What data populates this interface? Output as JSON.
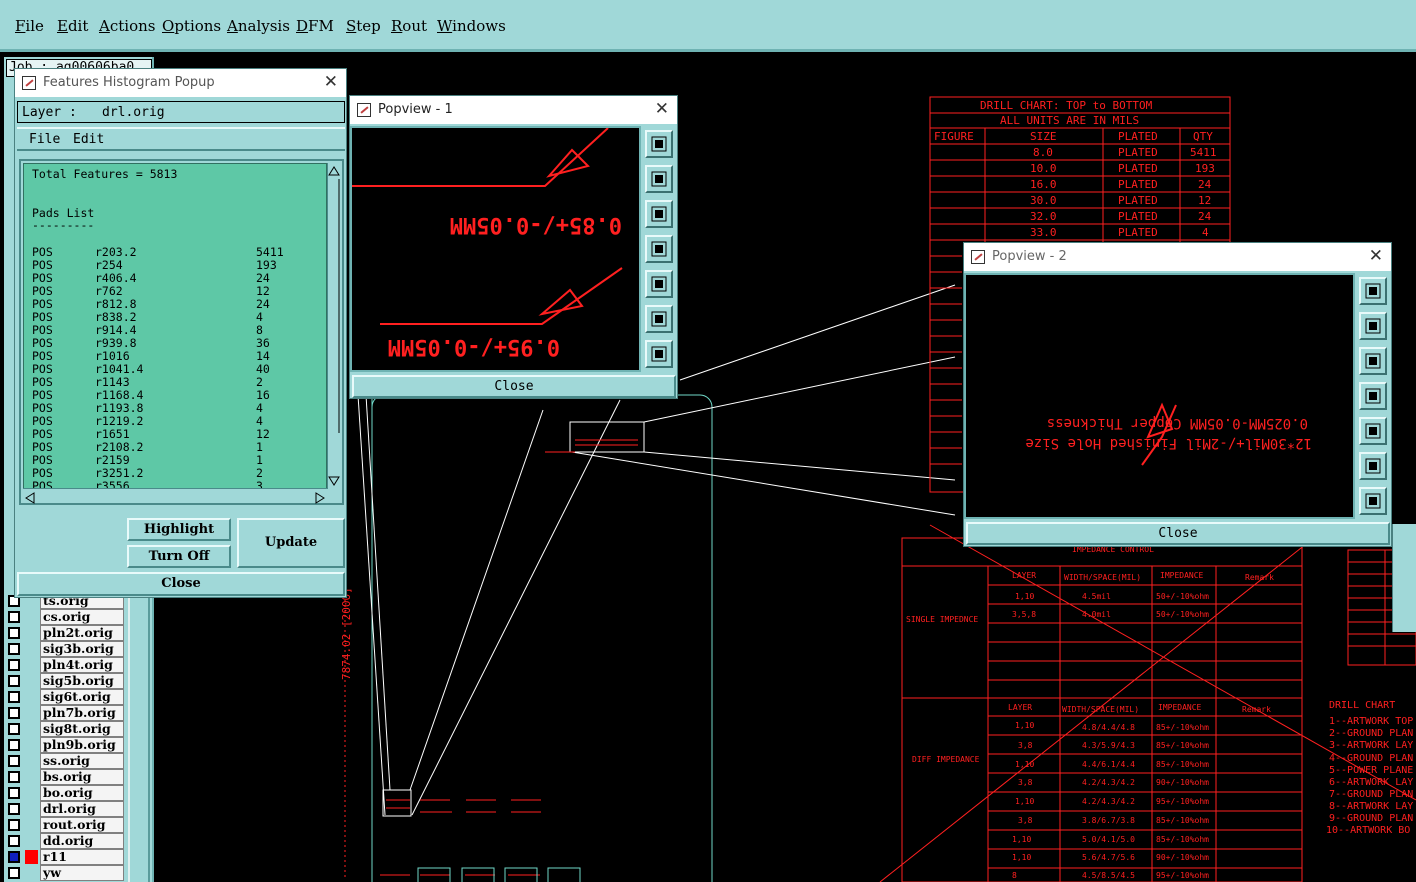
{
  "menubar": {
    "items": [
      "File",
      "Edit",
      "Actions",
      "Options",
      "Analysis",
      "DFM",
      "Step",
      "Rout",
      "Windows"
    ]
  },
  "left_panel": {
    "job_label": "Job : ag00606ba0",
    "layers": [
      {
        "name": "ts.orig",
        "active": false,
        "color": null
      },
      {
        "name": "cs.orig",
        "active": false,
        "color": null
      },
      {
        "name": "pln2t.orig",
        "active": false,
        "color": null
      },
      {
        "name": "sig3b.orig",
        "active": false,
        "color": null
      },
      {
        "name": "pln4t.orig",
        "active": false,
        "color": null
      },
      {
        "name": "sig5b.orig",
        "active": false,
        "color": null
      },
      {
        "name": "sig6t.orig",
        "active": false,
        "color": null
      },
      {
        "name": "pln7b.orig",
        "active": false,
        "color": null
      },
      {
        "name": "sig8t.orig",
        "active": false,
        "color": null
      },
      {
        "name": "pln9b.orig",
        "active": false,
        "color": null
      },
      {
        "name": "ss.orig",
        "active": false,
        "color": null
      },
      {
        "name": "bs.orig",
        "active": false,
        "color": null
      },
      {
        "name": "bo.orig",
        "active": false,
        "color": null
      },
      {
        "name": "drl.orig",
        "active": false,
        "color": null
      },
      {
        "name": "rout.orig",
        "active": false,
        "color": null
      },
      {
        "name": "dd.orig",
        "active": false,
        "color": null
      },
      {
        "name": "r11",
        "active": true,
        "color": "#ff0000"
      },
      {
        "name": "yw",
        "active": false,
        "color": null
      }
    ]
  },
  "histogram_popup": {
    "title": "Features Histogram Popup",
    "layer_label": "Layer :",
    "layer_value": "drl.orig",
    "menu": [
      "File",
      "Edit"
    ],
    "total_line": "Total Features = 5813",
    "section_title": "Pads List",
    "section_rule": "---------",
    "rows": [
      {
        "pol": "POS",
        "sym": "r203.2",
        "count": "5411"
      },
      {
        "pol": "POS",
        "sym": "r254",
        "count": "193"
      },
      {
        "pol": "POS",
        "sym": "r406.4",
        "count": "24"
      },
      {
        "pol": "POS",
        "sym": "r762",
        "count": "12"
      },
      {
        "pol": "POS",
        "sym": "r812.8",
        "count": "24"
      },
      {
        "pol": "POS",
        "sym": "r838.2",
        "count": "4"
      },
      {
        "pol": "POS",
        "sym": "r914.4",
        "count": "8"
      },
      {
        "pol": "POS",
        "sym": "r939.8",
        "count": "36"
      },
      {
        "pol": "POS",
        "sym": "r1016",
        "count": "14"
      },
      {
        "pol": "POS",
        "sym": "r1041.4",
        "count": "40"
      },
      {
        "pol": "POS",
        "sym": "r1143",
        "count": "2"
      },
      {
        "pol": "POS",
        "sym": "r1168.4",
        "count": "16"
      },
      {
        "pol": "POS",
        "sym": "r1193.8",
        "count": "4"
      },
      {
        "pol": "POS",
        "sym": "r1219.2",
        "count": "4"
      },
      {
        "pol": "POS",
        "sym": "r1651",
        "count": "12"
      },
      {
        "pol": "POS",
        "sym": "r2108.2",
        "count": "1"
      },
      {
        "pol": "POS",
        "sym": "r2159",
        "count": "1"
      },
      {
        "pol": "POS",
        "sym": "r3251.2",
        "count": "2"
      },
      {
        "pol": "POS",
        "sym": "r3556",
        "count": "3"
      }
    ],
    "highlight_label": "Highlight",
    "turnoff_label": "Turn Off",
    "update_label": "Update",
    "close_label": "Close"
  },
  "popview1": {
    "title": "Popview - 1",
    "text_top": "0.85+/-0.05MM",
    "text_bottom": "0.95+/-0.05MM",
    "close_label": "Close"
  },
  "popview2": {
    "title": "Popview - 2",
    "line1": "0.025MM-0.05MM Copper Thickness",
    "line2": "12*30Mil+/-2Mil Finished Hole Size",
    "close_label": "Close"
  },
  "drill_chart": {
    "title": "DRILL CHART: TOP to BOTTOM",
    "subtitle": "ALL UNITS ARE IN MILS",
    "headers": [
      "FIGURE",
      "SIZE",
      "PLATED",
      "QTY"
    ],
    "rows": [
      [
        "",
        "8.0",
        "PLATED",
        "5411"
      ],
      [
        "",
        "10.0",
        "PLATED",
        "193"
      ],
      [
        "",
        "16.0",
        "PLATED",
        "24"
      ],
      [
        "",
        "30.0",
        "PLATED",
        "12"
      ],
      [
        "",
        "32.0",
        "PLATED",
        "24"
      ],
      [
        "",
        "33.0",
        "PLATED",
        "4"
      ]
    ]
  },
  "impedance_table": {
    "title": "IMPEDANCE CONTROL",
    "single_label": "SINGLE IMPEDNCE",
    "diff_label": "DIFF IMPEDANCE",
    "single_headers": [
      "LAYER",
      "WIDTH/SPACE(MIL)",
      "IMPEDANCE",
      "Remark"
    ],
    "single_rows": [
      [
        "1,10",
        "4.5mil",
        "50+/-10%ohm"
      ],
      [
        "3,5,8",
        "4.0mil",
        "50+/-10%ohm"
      ]
    ],
    "diff_headers": [
      "LAYER",
      "WIDTH/SPACE(MIL)",
      "IMPEDANCE",
      "Remark"
    ],
    "diff_rows": [
      [
        "1,10",
        "4.8/4.4/4.8",
        "85+/-10%ohm"
      ],
      [
        "3,8",
        "4.3/5.9/4.3",
        "85+/-10%ohm"
      ],
      [
        "1,10",
        "4.4/6.1/4.4",
        "85+/-10%ohm"
      ],
      [
        "3,8",
        "4.2/4.3/4.2",
        "90+/-10%ohm"
      ],
      [
        "1,10",
        "4.2/4.3/4.2",
        "95+/-10%ohm"
      ],
      [
        "3,8",
        "3.8/6.7/3.8",
        "85+/-10%ohm"
      ],
      [
        "1,10",
        "5.0/4.1/5.0",
        "85+/-10%ohm"
      ],
      [
        "1,10",
        "5.6/4.7/5.6",
        "90+/-10%ohm"
      ],
      [
        "8",
        "4.5/8.5/4.5",
        "95+/-10%ohm"
      ]
    ]
  },
  "drill_legend": {
    "title": "DRILL CHART",
    "items": [
      "1--ARTWORK TOP",
      "2--GROUND PLAN",
      "3--ARTWORK LAY",
      "4--GROUND PLAN",
      "5--POWER PLANE",
      "6--ARTWORK LAY",
      "7--GROUND PLAN",
      "8--ARTWORK LAY",
      "9--GROUND PLAN",
      "10--ARTWORK BO"
    ]
  },
  "board": {
    "dimension_label": "7874.02 [2000]"
  },
  "colors": {
    "ui_bg": "#a0d8d8",
    "list_bg": "#5ec8a6",
    "drawing_red": "#ff2020",
    "outline_cyan": "#70d8c8"
  }
}
